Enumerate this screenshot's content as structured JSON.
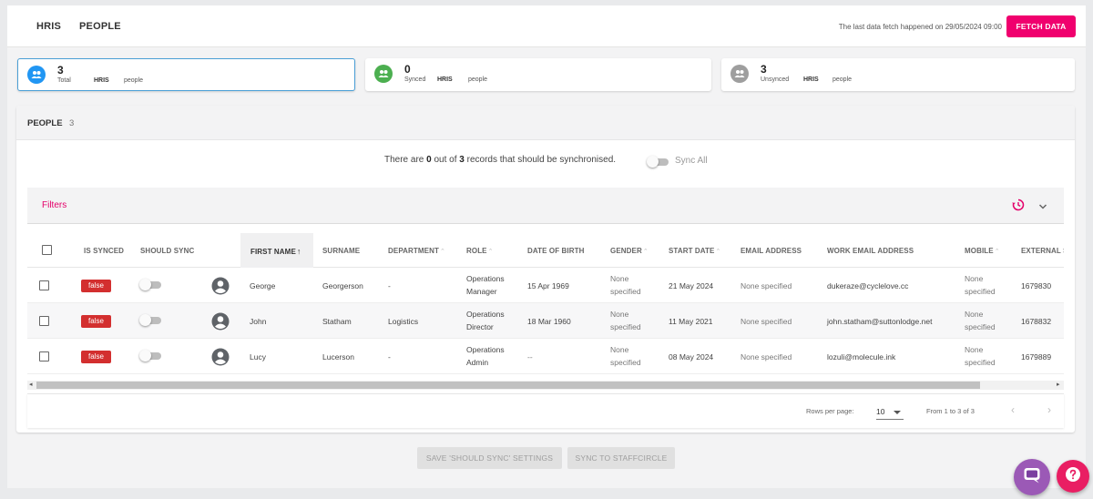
{
  "nav": {
    "tab_hris": "HRIS",
    "tab_people": "PEOPLE"
  },
  "header": {
    "fetch_info": "The last data fetch happened on 29/05/2024 09:00",
    "fetch_button": "FETCH DATA"
  },
  "stats": [
    {
      "count": "3",
      "label": "Total",
      "source": "HRIS",
      "unit": "people",
      "color": "#2196f3"
    },
    {
      "count": "0",
      "label": "Synced",
      "source": "HRIS",
      "unit": "people",
      "color": "#4caf50"
    },
    {
      "count": "3",
      "label": "Unsynced",
      "source": "HRIS",
      "unit": "people",
      "color": "#9e9e9e"
    }
  ],
  "panel": {
    "title": "PEOPLE",
    "count": "3",
    "sync_text_pre": "There are ",
    "sync_count": "0",
    "sync_text_mid": " out of ",
    "sync_total": "3",
    "sync_text_post": " records that should be synchronised.",
    "sync_all_label": "Sync All",
    "filters_label": "Filters"
  },
  "table": {
    "headers": {
      "is_synced": "IS SYNCED",
      "should_sync": "SHOULD SYNC",
      "first_name": "FIRST NAME",
      "surname": "SURNAME",
      "department": "DEPARTMENT",
      "role": "ROLE",
      "dob": "DATE OF BIRTH",
      "gender": "GENDER",
      "start_date": "START DATE",
      "email": "EMAIL ADDRESS",
      "work_email": "WORK EMAIL ADDRESS",
      "mobile": "MOBILE",
      "external": "EXTERNAL SY"
    },
    "rows": [
      {
        "is_synced": "false",
        "first_name": "George",
        "surname": "Georgerson",
        "department": "-",
        "role_1": "Operations",
        "role_2": "Manager",
        "dob": "15 Apr 1969",
        "gender_1": "None",
        "gender_2": "specified",
        "start_date": "21 May 2024",
        "email": "None specified",
        "work_email": "dukeraze@cyclelove.cc",
        "mobile_1": "None",
        "mobile_2": "specified",
        "external": "1679830"
      },
      {
        "is_synced": "false",
        "first_name": "John",
        "surname": "Statham",
        "department": "Logistics",
        "role_1": "Operations",
        "role_2": "Director",
        "dob": "18 Mar 1960",
        "gender_1": "None",
        "gender_2": "specified",
        "start_date": "11 May 2021",
        "email": "None specified",
        "work_email": "john.statham@suttonlodge.net",
        "mobile_1": "None",
        "mobile_2": "specified",
        "external": "1678832"
      },
      {
        "is_synced": "false",
        "first_name": "Lucy",
        "surname": "Lucerson",
        "department": "-",
        "role_1": "Operations",
        "role_2": "Admin",
        "dob": "--",
        "gender_1": "None",
        "gender_2": "specified",
        "start_date": "08 May 2024",
        "email": "None specified",
        "work_email": "lozuli@molecule.ink",
        "mobile_1": "None",
        "mobile_2": "specified",
        "external": "1679889"
      }
    ]
  },
  "pager": {
    "rows_per_page_label": "Rows per page:",
    "rows_per_page": "10",
    "range": "From 1 to 3 of 3"
  },
  "actions": {
    "save_label": "SAVE 'SHOULD SYNC' SETTINGS",
    "sync_label": "SYNC TO STAFFCIRCLE"
  },
  "icons": {
    "people": "group-icon",
    "avatar": "account-circle-icon",
    "reset": "history-icon",
    "chevron": "chevron-down-icon",
    "chat": "chat-bubble-icon",
    "help": "help-icon"
  },
  "colors": {
    "accent": "#f0006e",
    "false_badge": "#d32f2f",
    "active_card_border": "#4a9fd6"
  }
}
